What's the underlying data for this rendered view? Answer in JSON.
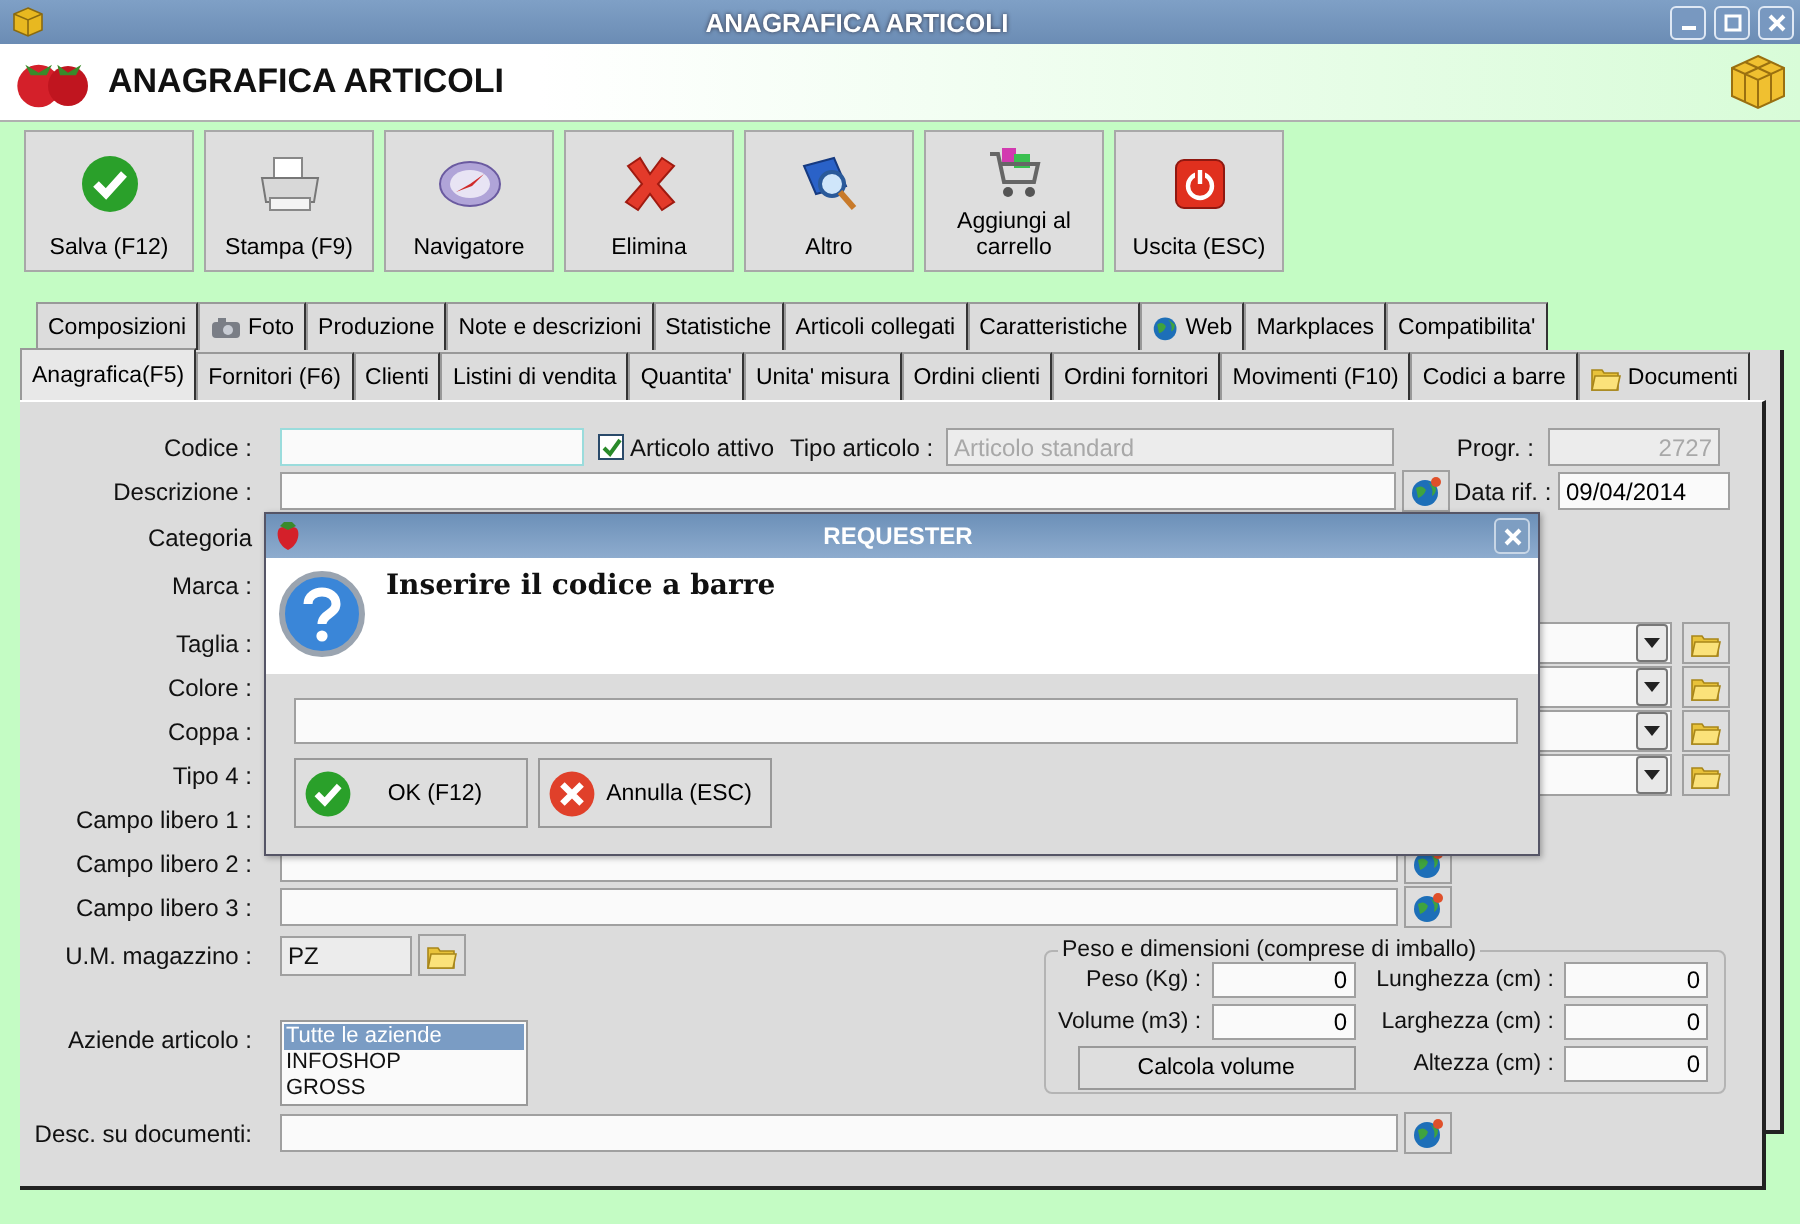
{
  "window": {
    "title": "ANAGRAFICA ARTICOLI"
  },
  "header": {
    "title": "ANAGRAFICA ARTICOLI"
  },
  "toolbar": [
    {
      "label": "Salva (F12)",
      "kind": "check"
    },
    {
      "label": "Stampa (F9)",
      "kind": "printer"
    },
    {
      "label": "Navigatore",
      "kind": "compass"
    },
    {
      "label": "Elimina",
      "kind": "cross"
    },
    {
      "label": "Altro",
      "kind": "book"
    },
    {
      "label": "Aggiungi al carrello",
      "kind": "cart"
    },
    {
      "label": "Uscita (ESC)",
      "kind": "power"
    }
  ],
  "tab_rows": [
    [
      {
        "label": "Composizioni",
        "kind": "plain",
        "selected": false
      },
      {
        "label": "Foto",
        "kind": "camera",
        "selected": false
      },
      {
        "label": "Produzione",
        "kind": "plain",
        "selected": false
      },
      {
        "label": "Note e descrizioni",
        "kind": "plain",
        "selected": false
      },
      {
        "label": "Statistiche",
        "kind": "plain",
        "selected": false
      },
      {
        "label": "Articoli collegati",
        "kind": "plain",
        "selected": false
      },
      {
        "label": "Caratteristiche",
        "kind": "plain",
        "selected": false
      },
      {
        "label": "Web",
        "kind": "globe",
        "selected": false
      },
      {
        "label": "Markplaces",
        "kind": "plain",
        "selected": false
      },
      {
        "label": "Compatibilita'",
        "kind": "plain",
        "selected": false
      }
    ],
    [
      {
        "label": "Anagrafica(F5)",
        "kind": "plain",
        "selected": true
      },
      {
        "label": "Fornitori (F6)",
        "kind": "plain",
        "selected": false
      },
      {
        "label": "Clienti",
        "kind": "plain",
        "selected": false
      },
      {
        "label": "Listini di vendita",
        "kind": "plain",
        "selected": false
      },
      {
        "label": "Quantita'",
        "kind": "plain",
        "selected": false
      },
      {
        "label": "Unita' misura",
        "kind": "plain",
        "selected": false
      },
      {
        "label": "Ordini clienti",
        "kind": "plain",
        "selected": false
      },
      {
        "label": "Ordini fornitori",
        "kind": "plain",
        "selected": false
      },
      {
        "label": "Movimenti (F10)",
        "kind": "plain",
        "selected": false
      },
      {
        "label": "Codici a barre",
        "kind": "plain",
        "selected": false
      },
      {
        "label": "Documenti",
        "kind": "folder",
        "selected": false
      }
    ]
  ],
  "form": {
    "codice_label": "Codice :",
    "articolo_attivo": {
      "label": "Articolo attivo",
      "checked": true
    },
    "tipo_articolo": {
      "label": "Tipo articolo :",
      "value": "Articolo standard",
      "disabled": true
    },
    "progr": {
      "label": "Progr. :",
      "value": "2727"
    },
    "descrizione_label": "Descrizione :",
    "data_rif": {
      "label": "Data rif. :",
      "value": "09/04/2014"
    },
    "covered_labels": [
      "Categoria",
      "Marca :"
    ],
    "combo_rows": [
      {
        "label": "Taglia :"
      },
      {
        "label": "Colore :"
      },
      {
        "label": "Coppa :"
      },
      {
        "label": "Tipo 4 :"
      }
    ],
    "campo_libero_1_label": "Campo libero 1 :",
    "campi_liberi": [
      {
        "label": "Campo libero 2 :"
      },
      {
        "label": "Campo libero 3 :"
      }
    ],
    "um_magazzino": {
      "label": "U.M. magazzino :",
      "value": "PZ"
    },
    "aziende": {
      "label": "Aziende articolo :",
      "items": [
        {
          "text": "Tutte le aziende",
          "selected": true
        },
        {
          "text": "INFOSHOP",
          "selected": false
        },
        {
          "text": "GROSS",
          "selected": false
        }
      ]
    },
    "peso_dimensioni": {
      "title": "Peso e dimensioni (comprese di imballo)",
      "left_fields": [
        {
          "label": "Peso (Kg) :",
          "value": "0"
        },
        {
          "label": "Volume (m3) :",
          "value": "0"
        }
      ],
      "button": "Calcola volume",
      "right_fields": [
        {
          "label": "Lunghezza (cm) :",
          "value": "0"
        },
        {
          "label": "Larghezza (cm) :",
          "value": "0"
        },
        {
          "label": "Altezza (cm) :",
          "value": "0"
        }
      ]
    },
    "desc_documenti_label": "Desc. su documenti:"
  },
  "dialog": {
    "title": "REQUESTER",
    "message": "Inserire il codice a barre",
    "buttons": [
      {
        "label": "OK (F12)",
        "kind": "ok"
      },
      {
        "label": "Annulla (ESC)",
        "kind": "cancel"
      }
    ]
  }
}
